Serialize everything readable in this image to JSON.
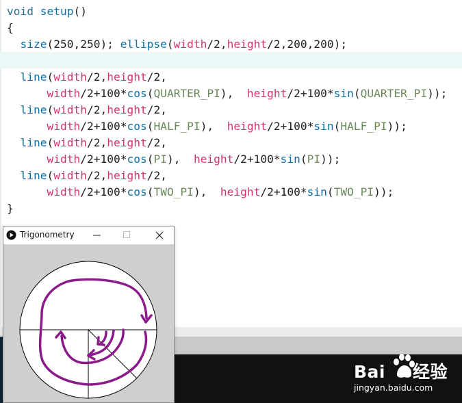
{
  "editor": {
    "lines": [
      [
        {
          "t": "void ",
          "c": "kw"
        },
        {
          "t": "setup",
          "c": "fn"
        },
        {
          "t": "()",
          "c": ""
        }
      ],
      [
        {
          "t": "{",
          "c": ""
        }
      ],
      [
        {
          "t": "  ",
          "c": ""
        },
        {
          "t": "size",
          "c": "fn"
        },
        {
          "t": "(250,250); ",
          "c": ""
        },
        {
          "t": "ellipse",
          "c": "fn"
        },
        {
          "t": "(",
          "c": ""
        },
        {
          "t": "width",
          "c": "var"
        },
        {
          "t": "/2,",
          "c": ""
        },
        {
          "t": "height",
          "c": "var"
        },
        {
          "t": "/2,200,200);",
          "c": ""
        }
      ],
      [
        {
          "t": "",
          "c": ""
        }
      ],
      [
        {
          "t": "  ",
          "c": ""
        },
        {
          "t": "line",
          "c": "fn"
        },
        {
          "t": "(",
          "c": ""
        },
        {
          "t": "width",
          "c": "var"
        },
        {
          "t": "/2,",
          "c": ""
        },
        {
          "t": "height",
          "c": "var"
        },
        {
          "t": "/2,",
          "c": ""
        }
      ],
      [
        {
          "t": "      ",
          "c": ""
        },
        {
          "t": "width",
          "c": "var"
        },
        {
          "t": "/2+100*",
          "c": ""
        },
        {
          "t": "cos",
          "c": "fn"
        },
        {
          "t": "(",
          "c": ""
        },
        {
          "t": "QUARTER_PI",
          "c": "con"
        },
        {
          "t": "),  ",
          "c": ""
        },
        {
          "t": "height",
          "c": "var"
        },
        {
          "t": "/2+100*",
          "c": ""
        },
        {
          "t": "sin",
          "c": "fn"
        },
        {
          "t": "(",
          "c": ""
        },
        {
          "t": "QUARTER_PI",
          "c": "con"
        },
        {
          "t": "));",
          "c": ""
        }
      ],
      [
        {
          "t": "  ",
          "c": ""
        },
        {
          "t": "line",
          "c": "fn"
        },
        {
          "t": "(",
          "c": ""
        },
        {
          "t": "width",
          "c": "var"
        },
        {
          "t": "/2,",
          "c": ""
        },
        {
          "t": "height",
          "c": "var"
        },
        {
          "t": "/2,",
          "c": ""
        }
      ],
      [
        {
          "t": "      ",
          "c": ""
        },
        {
          "t": "width",
          "c": "var"
        },
        {
          "t": "/2+100*",
          "c": ""
        },
        {
          "t": "cos",
          "c": "fn"
        },
        {
          "t": "(",
          "c": ""
        },
        {
          "t": "HALF_PI",
          "c": "con"
        },
        {
          "t": "),  ",
          "c": ""
        },
        {
          "t": "height",
          "c": "var"
        },
        {
          "t": "/2+100*",
          "c": ""
        },
        {
          "t": "sin",
          "c": "fn"
        },
        {
          "t": "(",
          "c": ""
        },
        {
          "t": "HALF_PI",
          "c": "con"
        },
        {
          "t": "));",
          "c": ""
        }
      ],
      [
        {
          "t": "  ",
          "c": ""
        },
        {
          "t": "line",
          "c": "fn"
        },
        {
          "t": "(",
          "c": ""
        },
        {
          "t": "width",
          "c": "var"
        },
        {
          "t": "/2,",
          "c": ""
        },
        {
          "t": "height",
          "c": "var"
        },
        {
          "t": "/2,",
          "c": ""
        }
      ],
      [
        {
          "t": "      ",
          "c": ""
        },
        {
          "t": "width",
          "c": "var"
        },
        {
          "t": "/2+100*",
          "c": ""
        },
        {
          "t": "cos",
          "c": "fn"
        },
        {
          "t": "(",
          "c": ""
        },
        {
          "t": "PI",
          "c": "con"
        },
        {
          "t": "),  ",
          "c": ""
        },
        {
          "t": "height",
          "c": "var"
        },
        {
          "t": "/2+100*",
          "c": ""
        },
        {
          "t": "sin",
          "c": "fn"
        },
        {
          "t": "(",
          "c": ""
        },
        {
          "t": "PI",
          "c": "con"
        },
        {
          "t": "));",
          "c": ""
        }
      ],
      [
        {
          "t": "  ",
          "c": ""
        },
        {
          "t": "line",
          "c": "fn"
        },
        {
          "t": "(",
          "c": ""
        },
        {
          "t": "width",
          "c": "var"
        },
        {
          "t": "/2,",
          "c": ""
        },
        {
          "t": "height",
          "c": "var"
        },
        {
          "t": "/2,",
          "c": ""
        }
      ],
      [
        {
          "t": "      ",
          "c": ""
        },
        {
          "t": "width",
          "c": "var"
        },
        {
          "t": "/2+100*",
          "c": ""
        },
        {
          "t": "cos",
          "c": "fn"
        },
        {
          "t": "(",
          "c": ""
        },
        {
          "t": "TWO_PI",
          "c": "con"
        },
        {
          "t": "),  ",
          "c": ""
        },
        {
          "t": "height",
          "c": "var"
        },
        {
          "t": "/2+100*",
          "c": ""
        },
        {
          "t": "sin",
          "c": "fn"
        },
        {
          "t": "(",
          "c": ""
        },
        {
          "t": "TWO_PI",
          "c": "con"
        },
        {
          "t": "));",
          "c": ""
        }
      ],
      [
        {
          "t": "}",
          "c": ""
        }
      ]
    ],
    "current_line": 4,
    "colors": {
      "keyword": "#2f6d8f",
      "function": "#0d6ea8",
      "variable": "#d5336c",
      "constant": "#6a8a5a",
      "current_line_bg": "#eaf8f8"
    }
  },
  "sketch_window": {
    "title": "Trigonometry",
    "icons": {
      "app": "processing-play-icon",
      "minimize": "minimize-icon",
      "maximize": "maximize-icon",
      "close": "close-icon"
    },
    "canvas_bg": "#cfcfcf",
    "annotation_color": "#8b1a8b"
  },
  "console": {
    "background": "#111111"
  },
  "watermark": {
    "brand_left": "Bai",
    "brand_right": "经验",
    "url": "jingyan.baidu.com"
  }
}
